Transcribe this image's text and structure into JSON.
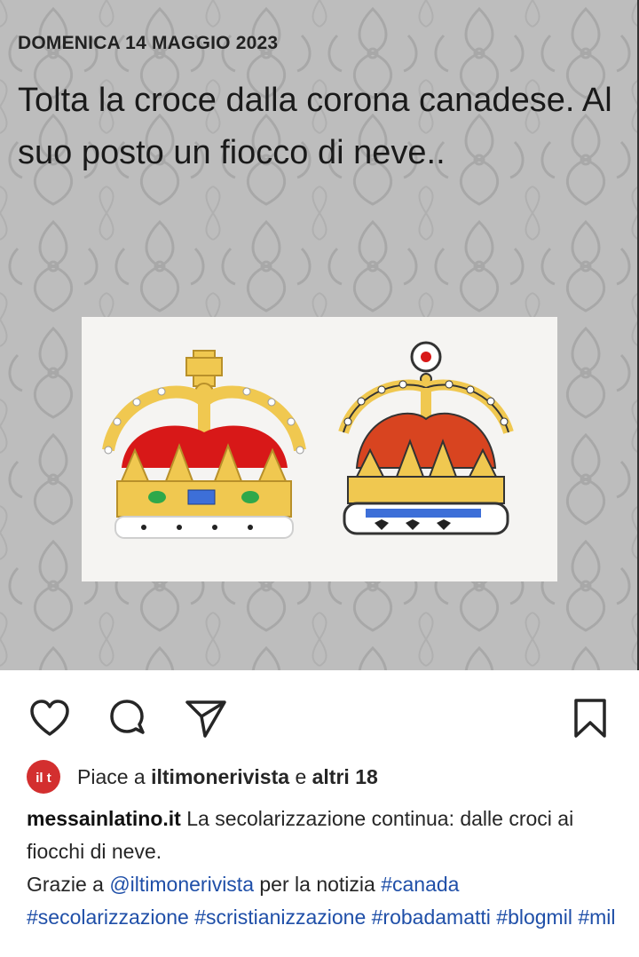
{
  "post": {
    "date": "DOMENICA 14 MAGGIO 2023",
    "headline": "Tolta la croce dalla corona canadese. Al suo posto un fiocco di neve..",
    "image_alt": "Two crowns"
  },
  "actions": {
    "like_icon": "heart-icon",
    "comment_icon": "comment-icon",
    "share_icon": "send-icon",
    "save_icon": "bookmark-icon"
  },
  "likes": {
    "avatar_text": "il t",
    "prefix": "Piace a",
    "user": "iltimonerivista",
    "conjunction": "e",
    "others": "altri 18"
  },
  "caption": {
    "username": "messainlatino.it",
    "text1": "La secolarizzazione continua: dalle croci ai fiocchi di neve.",
    "thanks": "Grazie a",
    "mention": "@iltimonerivista",
    "text2": "per la notizia",
    "hashtags": [
      "#canada",
      "#secolarizzazione",
      "#scristianizzazione",
      "#robadamatti",
      "#blogmil",
      "#mil"
    ]
  },
  "colors": {
    "background_pattern": "#bdbdbd",
    "link": "#1f4fa8",
    "avatar_red": "#d32f2f"
  }
}
